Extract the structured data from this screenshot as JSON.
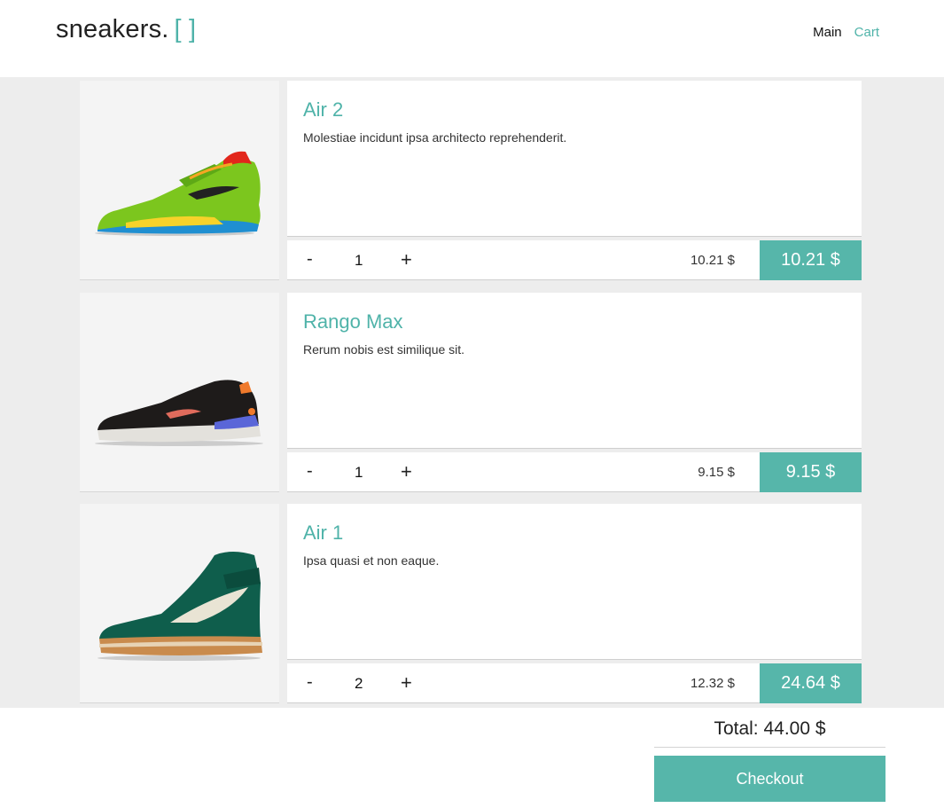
{
  "header": {
    "logo_text": "sneakers.",
    "logo_brackets": "[ ]",
    "nav": {
      "main": "Main",
      "cart": "Cart"
    }
  },
  "cart": {
    "items": [
      {
        "name": "Air 2",
        "description": "Molestiae incidunt ipsa architecto reprehenderit.",
        "minus": "-",
        "quantity": "1",
        "plus": "+",
        "unit_price": "10.21 $",
        "line_total": "10.21 $",
        "image_icon": "green-basketball-sneaker-image"
      },
      {
        "name": "Rango Max",
        "description": "Rerum nobis est similique sit.",
        "minus": "-",
        "quantity": "1",
        "plus": "+",
        "unit_price": "9.15 $",
        "line_total": "9.15 $",
        "image_icon": "black-running-sneaker-image"
      },
      {
        "name": "Air 1",
        "description": "Ipsa quasi et non eaque.",
        "minus": "-",
        "quantity": "2",
        "plus": "+",
        "unit_price": "12.32 $",
        "line_total": "24.64 $",
        "image_icon": "green-high-top-sneaker-image"
      }
    ],
    "total": "Total: 44.00 $",
    "checkout_label": "Checkout"
  },
  "colors": {
    "accent": "#56b6aa",
    "background": "#ededed"
  }
}
